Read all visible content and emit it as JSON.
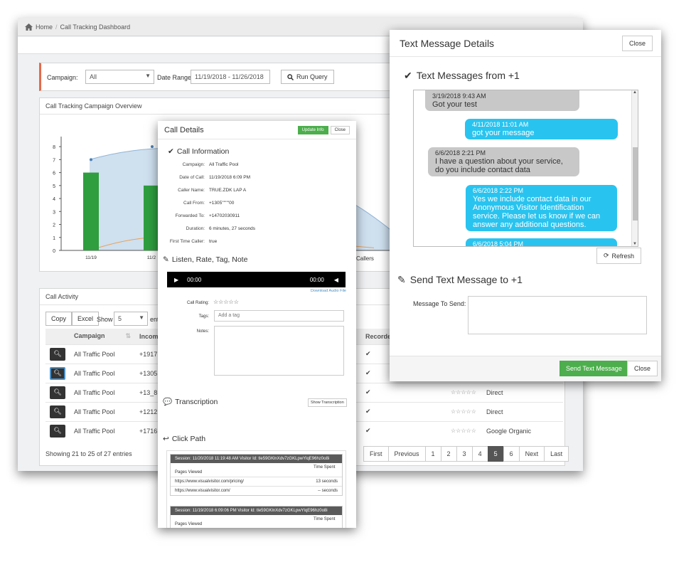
{
  "breadcrumb": {
    "home": "Home",
    "sep": "/",
    "current": "Call Tracking Dashboard"
  },
  "query": {
    "campaign_label": "Campaign:",
    "campaign_value": "All",
    "date_label": "Date Range:",
    "date_value": "11/19/2018 - 11/26/2018",
    "run_label": "Run Query"
  },
  "overview": {
    "title": "Call Tracking Campaign Overview",
    "y_ticks": [
      "8",
      "7",
      "6",
      "5",
      "4",
      "3",
      "2",
      "1",
      "0"
    ],
    "x_labels": [
      "11/19",
      "11/2"
    ],
    "legend_partial": "Callers"
  },
  "chart_data": {
    "type": "bar",
    "categories": [
      "11/19",
      "11/2"
    ],
    "values": [
      6,
      5
    ],
    "ylim": [
      0,
      8.5
    ]
  },
  "activity": {
    "title": "Call Activity",
    "copy": "Copy",
    "excel": "Excel",
    "show": "Show",
    "show_value": "5",
    "entries_partial": "ent",
    "columns": [
      "Campaign",
      "Incomi",
      "Recorded"
    ],
    "rows": [
      {
        "campaign": "All Traffic Pool",
        "incoming": "+1917",
        "rating": "",
        "source": ""
      },
      {
        "campaign": "All Traffic Pool",
        "incoming": "+1305",
        "rating": "",
        "source": ""
      },
      {
        "campaign": "All Traffic Pool",
        "incoming": "+13_8",
        "rating": "☆☆☆☆☆",
        "source": "Direct"
      },
      {
        "campaign": "All Traffic Pool",
        "incoming": "+1212",
        "rating": "☆☆☆☆☆",
        "source": "Direct"
      },
      {
        "campaign": "All Traffic Pool",
        "incoming": "+1716",
        "rating": "☆☆☆☆☆",
        "source": "Google Organic"
      }
    ],
    "check": "✔",
    "showing": "Showing 21 to 25 of 27 entries",
    "pages": [
      "First",
      "Previous",
      "1",
      "2",
      "3",
      "4",
      "5",
      "6",
      "Next",
      "Last"
    ]
  },
  "call_details": {
    "title": "Call Details",
    "update": "Update Info",
    "close": "Close",
    "info_title": "Call Information",
    "fields": [
      {
        "k": "Campaign:",
        "v": "All Traffic Pool"
      },
      {
        "k": "Date of Call:",
        "v": "11/19/2018 6:09 PM"
      },
      {
        "k": "Caller Name:",
        "v": "TRUE.ZDK LAP A"
      },
      {
        "k": "Call From:",
        "v": "+1305''''''''00"
      },
      {
        "k": "Forwarded To:",
        "v": "+14702030911"
      },
      {
        "k": "Duration:",
        "v": "6 minutes, 27 seconds"
      },
      {
        "k": "First Time Caller:",
        "v": "true"
      }
    ],
    "listen_title": "Listen, Rate, Tag, Note",
    "time_start": "00:00",
    "time_end": "00:00",
    "download": "Download Audio File",
    "rating_label": "Call Rating:",
    "stars": "☆☆☆☆☆",
    "tags_label": "Tags:",
    "tags_placeholder": "Add a tag",
    "notes_label": "Notes:",
    "transcription": "Transcription",
    "show_transcription": "Show Transcription",
    "click_path": "Click Path",
    "sessions": [
      {
        "header": "Session: 11/20/2018 11:19:48 AM   Visitor Id: tle59GKlnXdv7zGKLpwYlqE96hz0o8i",
        "col1": "Pages Viewed",
        "col2": "Time Spent",
        "rows": [
          {
            "url": "https://www.visualvisitor.com/pricing/",
            "t": "13 seconds"
          },
          {
            "url": "https://www.visualvisitor.com/",
            "t": "-- seconds"
          }
        ]
      },
      {
        "header": "Session: 11/19/2018 6:09:06 PM   Visitor Id: tle59GKlnXdv7zGKLpwYlqE96hz0o8i",
        "col1": "Pages Viewed",
        "col2": "Time Spent",
        "rows": []
      }
    ]
  },
  "text_modal": {
    "title": "Text Message Details",
    "close": "Close",
    "from_label": "Text Messages from +1",
    "messages": [
      {
        "date": "3/19/2018 9:43 AM",
        "text": "Got your test"
      },
      {
        "date": "4/11/2018 11:01 AM",
        "text": "got your message"
      },
      {
        "date": "6/6/2018 2:21 PM",
        "text": "I have a question about your service, do you include contact data"
      },
      {
        "date": "6/6/2018 2:22 PM",
        "text": "Yes we include contact data in our Anonymous Visitor Identification service. Please let us know if we can answer any additional questions."
      },
      {
        "date": "6/6/2018 5:04 PM",
        "text": ""
      }
    ],
    "refresh": "Refresh",
    "send_title": "Send Text Message to +1",
    "message_label": "Message To Send:",
    "send_btn": "Send Text Message",
    "footer_close": "Close"
  }
}
